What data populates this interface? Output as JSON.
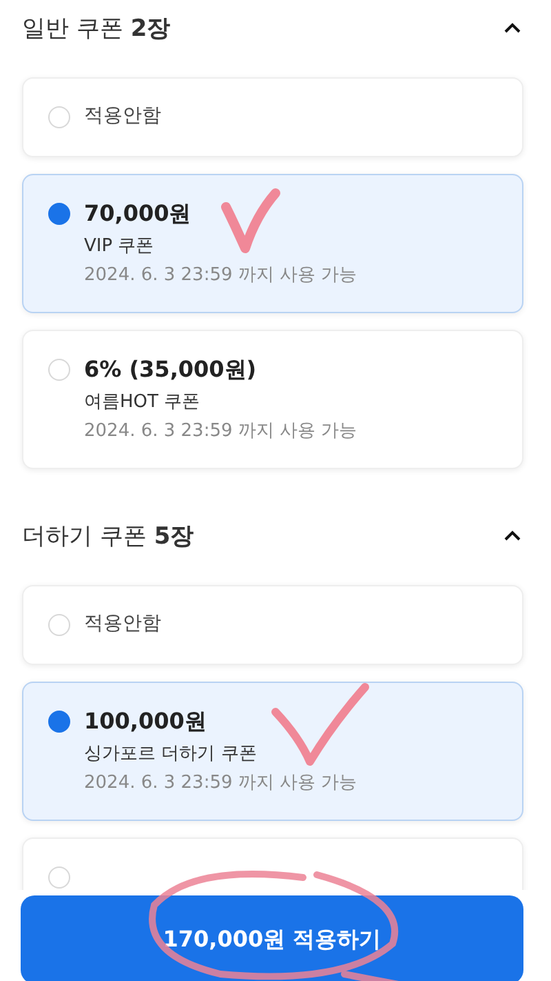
{
  "sections": [
    {
      "title": "일반 쿠폰 **2장**",
      "expanded": true,
      "coupons": [
        {
          "kind": "none",
          "label": "적용안함",
          "selected": false
        },
        {
          "kind": "coupon",
          "amount": "70,000원",
          "name": "VIP 쿠폰",
          "validity": "2024. 6. 3 23:59 까지 사용 가능",
          "selected": true
        },
        {
          "kind": "coupon",
          "amount": "6% (35,000원)",
          "name": "여름HOT 쿠폰",
          "validity": "2024. 6. 3 23:59 까지 사용 가능",
          "selected": false
        }
      ]
    },
    {
      "title": "더하기 쿠폰 **5장**",
      "expanded": true,
      "coupons": [
        {
          "kind": "none",
          "label": "적용안함",
          "selected": false
        },
        {
          "kind": "coupon",
          "amount": "100,000원",
          "name": "싱가포르 더하기 쿠폰",
          "validity": "2024. 6. 3 23:59 까지 사용 가능",
          "selected": true
        },
        {
          "kind": "partial",
          "selected": false
        }
      ]
    }
  ],
  "apply_button": "170,000원 적용하기"
}
